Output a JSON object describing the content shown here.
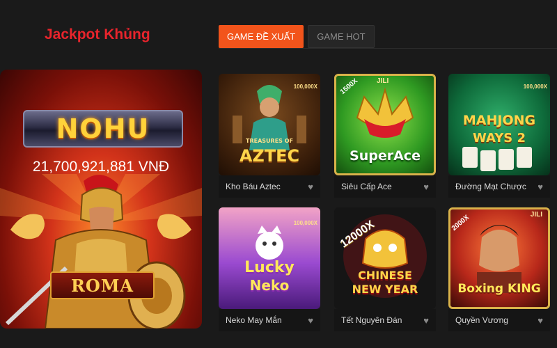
{
  "header": {
    "title": "Jackpot Khủng"
  },
  "tabs": [
    {
      "label": "GAME ĐỀ XUẤT",
      "active": true
    },
    {
      "label": "GAME HOT",
      "active": false
    }
  ],
  "jackpot": {
    "brand": "NOHU",
    "amount": "21,700,921,881 VNĐ",
    "game": "ROMA"
  },
  "games": [
    {
      "name": "Kho Báu Aztec",
      "art_title": "AZTEC",
      "art_sub": "TREASURES OF",
      "badge": "100,000X"
    },
    {
      "name": "Siêu Cấp Ace",
      "art_title": "SuperAce",
      "art_sub": "JILI",
      "badge": "1500X"
    },
    {
      "name": "Đường Mạt Chược",
      "art_title": "MAHJONG",
      "art_sub": "WAYS 2",
      "badge": "100,000X"
    },
    {
      "name": "Neko May Mắn",
      "art_title": "Lucky",
      "art_sub": "Neko",
      "badge": "100,000X"
    },
    {
      "name": "Tết Nguyên Đán",
      "art_title": "CHINESE",
      "art_sub": "NEW YEAR",
      "badge": "12000X"
    },
    {
      "name": "Quyền Vương",
      "art_title": "Boxing",
      "art_sub": "KING",
      "badge": "2000X"
    }
  ],
  "colors": {
    "accent": "#f2541b",
    "title": "#e8242c",
    "background": "#1a1a1a"
  },
  "icons": {
    "favorite": "heart-icon"
  }
}
